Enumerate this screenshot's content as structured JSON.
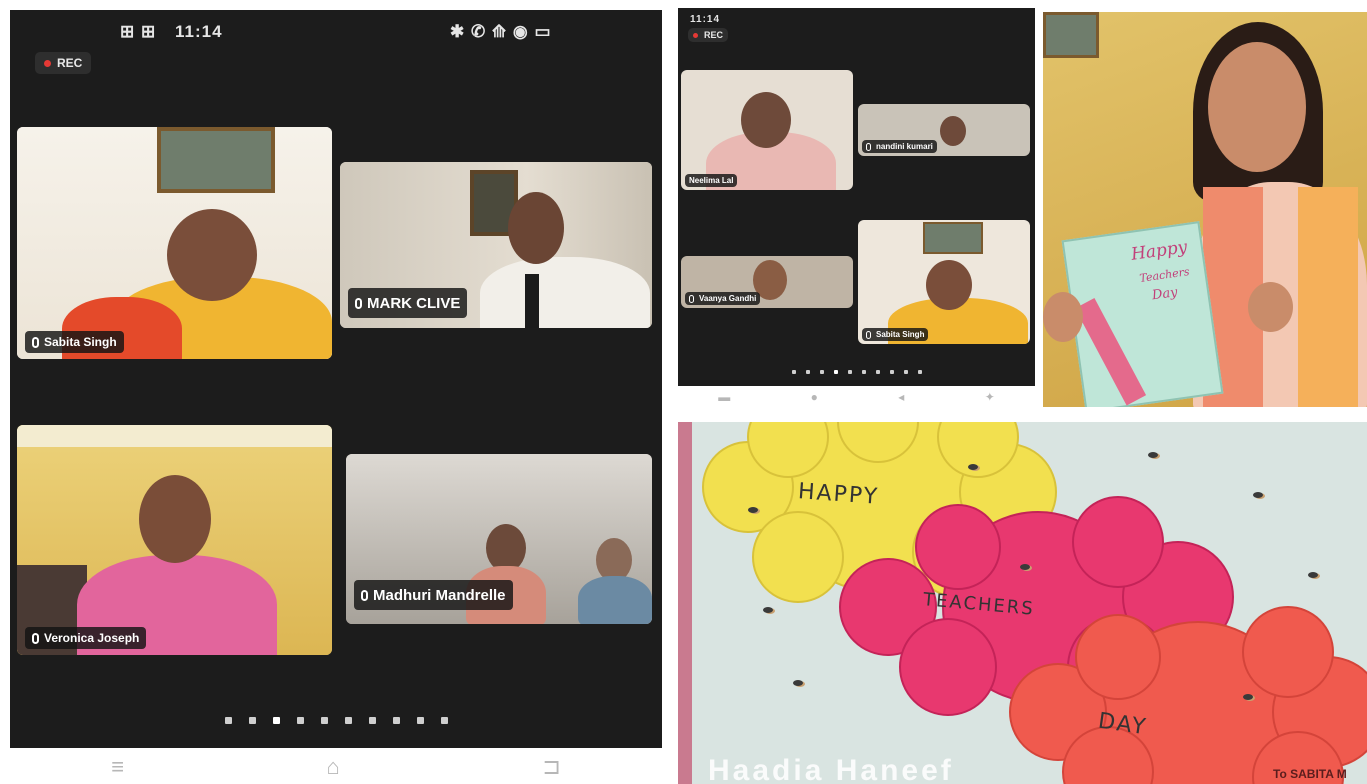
{
  "left_phone": {
    "status_time": "11:14",
    "status_left_icons": "⊞ ⊞",
    "status_right_icons": "✱ ✆ ⟰ ◉ ▭",
    "rec_label": "REC",
    "participants": [
      {
        "name": "Sabita Singh"
      },
      {
        "name": "MARK CLIVE"
      },
      {
        "name": "Veronica Joseph"
      },
      {
        "name": "Madhuri Mandrelle"
      }
    ],
    "page_dots": 10,
    "active_dot": 2,
    "nav_icons": [
      "menu-icon",
      "home-icon",
      "back-icon"
    ]
  },
  "right_phone": {
    "status_time": "11:14",
    "rec_label": "REC",
    "participants": [
      {
        "name": "Neelima Lal"
      },
      {
        "name": "nandini kumari"
      },
      {
        "name": "Vaanya Gandhi"
      },
      {
        "name": "Sabita Singh"
      }
    ],
    "page_dots": 10,
    "active_dot": 3
  },
  "girl_card": {
    "line1": "Happy",
    "line2": "Teachers",
    "line3": "Day"
  },
  "teacher_card": {
    "word1": "HAPPY",
    "word2": "TEACHERS",
    "word3": "DAY",
    "caption": "Haadia Haneef",
    "signature": "To SABITA M"
  },
  "colors": {
    "rec_dot": "#e53935",
    "flower_yellow": "#f2e04f",
    "flower_pink": "#e8386f",
    "flower_orange": "#f05a4e"
  }
}
